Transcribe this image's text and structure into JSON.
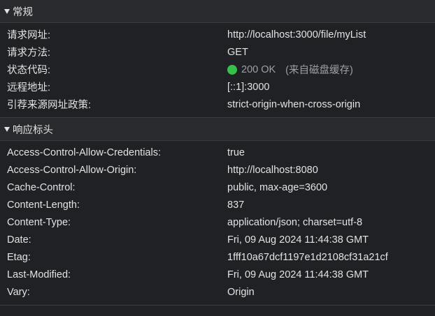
{
  "general": {
    "title": "常规",
    "rows": [
      {
        "key": "请求网址:",
        "value": "http://localhost:3000/file/myList"
      },
      {
        "key": "请求方法:",
        "value": "GET"
      },
      {
        "key": "状态代码:",
        "value": "200 OK",
        "note": "(来自磁盘缓存)",
        "status_color": "#34c04b"
      },
      {
        "key": "远程地址:",
        "value": "[::1]:3000"
      },
      {
        "key": "引荐来源网址政策:",
        "value": "strict-origin-when-cross-origin"
      }
    ]
  },
  "response_headers": {
    "title": "响应标头",
    "rows": [
      {
        "key": "Access-Control-Allow-Credentials:",
        "value": "true"
      },
      {
        "key": "Access-Control-Allow-Origin:",
        "value": "http://localhost:8080"
      },
      {
        "key": "Cache-Control:",
        "value": "public, max-age=3600"
      },
      {
        "key": "Content-Length:",
        "value": "837"
      },
      {
        "key": "Content-Type:",
        "value": "application/json; charset=utf-8"
      },
      {
        "key": "Date:",
        "value": "Fri, 09 Aug 2024 11:44:38 GMT"
      },
      {
        "key": "Etag:",
        "value": "1fff10a67dcf1197e1d2108cf31a21cf"
      },
      {
        "key": "Last-Modified:",
        "value": "Fri, 09 Aug 2024 11:44:38 GMT"
      },
      {
        "key": "Vary:",
        "value": "Origin"
      }
    ]
  }
}
